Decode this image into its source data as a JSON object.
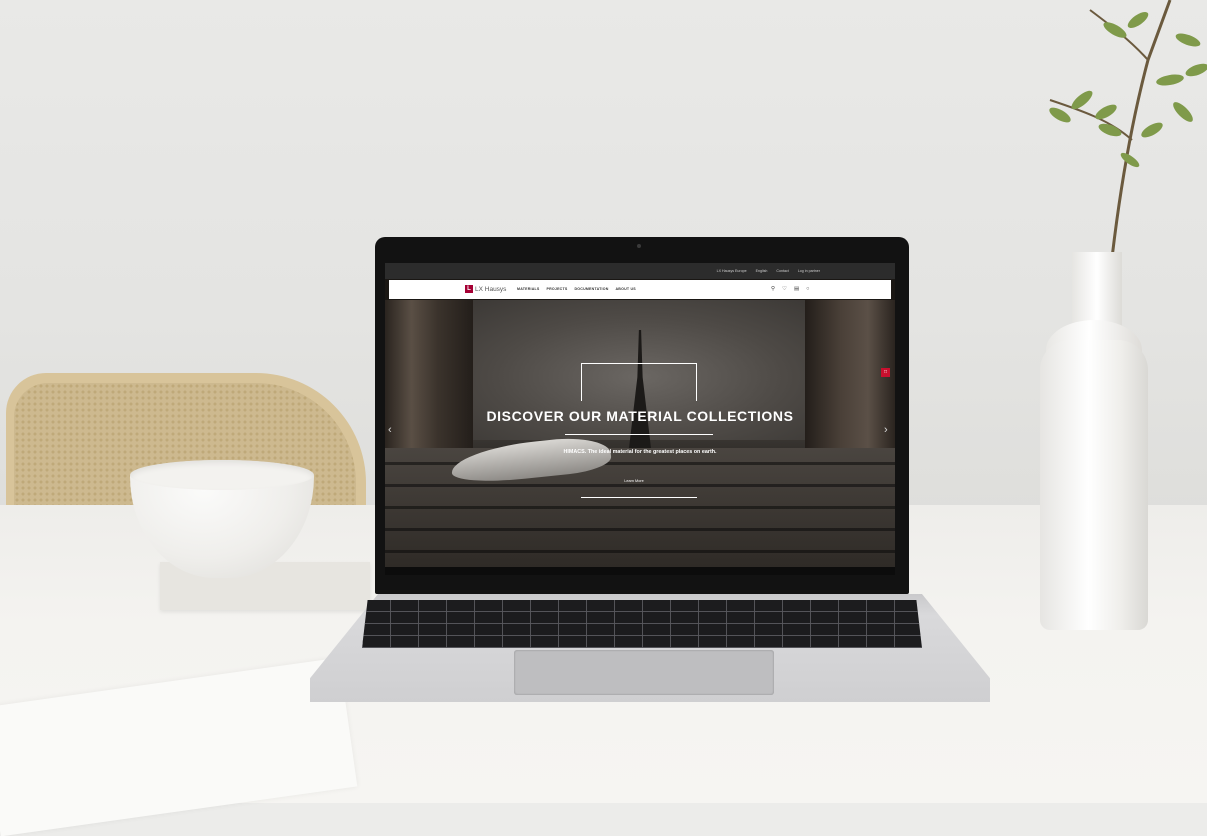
{
  "site": {
    "topbar": {
      "region": "LX Hausys Europe",
      "language": "English",
      "contact": "Contact",
      "login": "Log in partner"
    },
    "logo": {
      "mark": "L",
      "text": "LX Hausys"
    },
    "nav": [
      "MATERIALS",
      "PROJECTS",
      "DOCUMENTATION",
      "ABOUT US"
    ],
    "icons": [
      "search-icon",
      "heart-icon",
      "cart-icon",
      "user-icon"
    ],
    "hero": {
      "title": "DISCOVER OUR MATERIAL COLLECTIONS",
      "subtitle": "HIMACS. The ideal material for the greatest places on earth.",
      "button": "Learn More"
    },
    "colors": {
      "brand": "#a50034",
      "topbar": "#2c2c2c",
      "chat": "#c8102e"
    }
  }
}
